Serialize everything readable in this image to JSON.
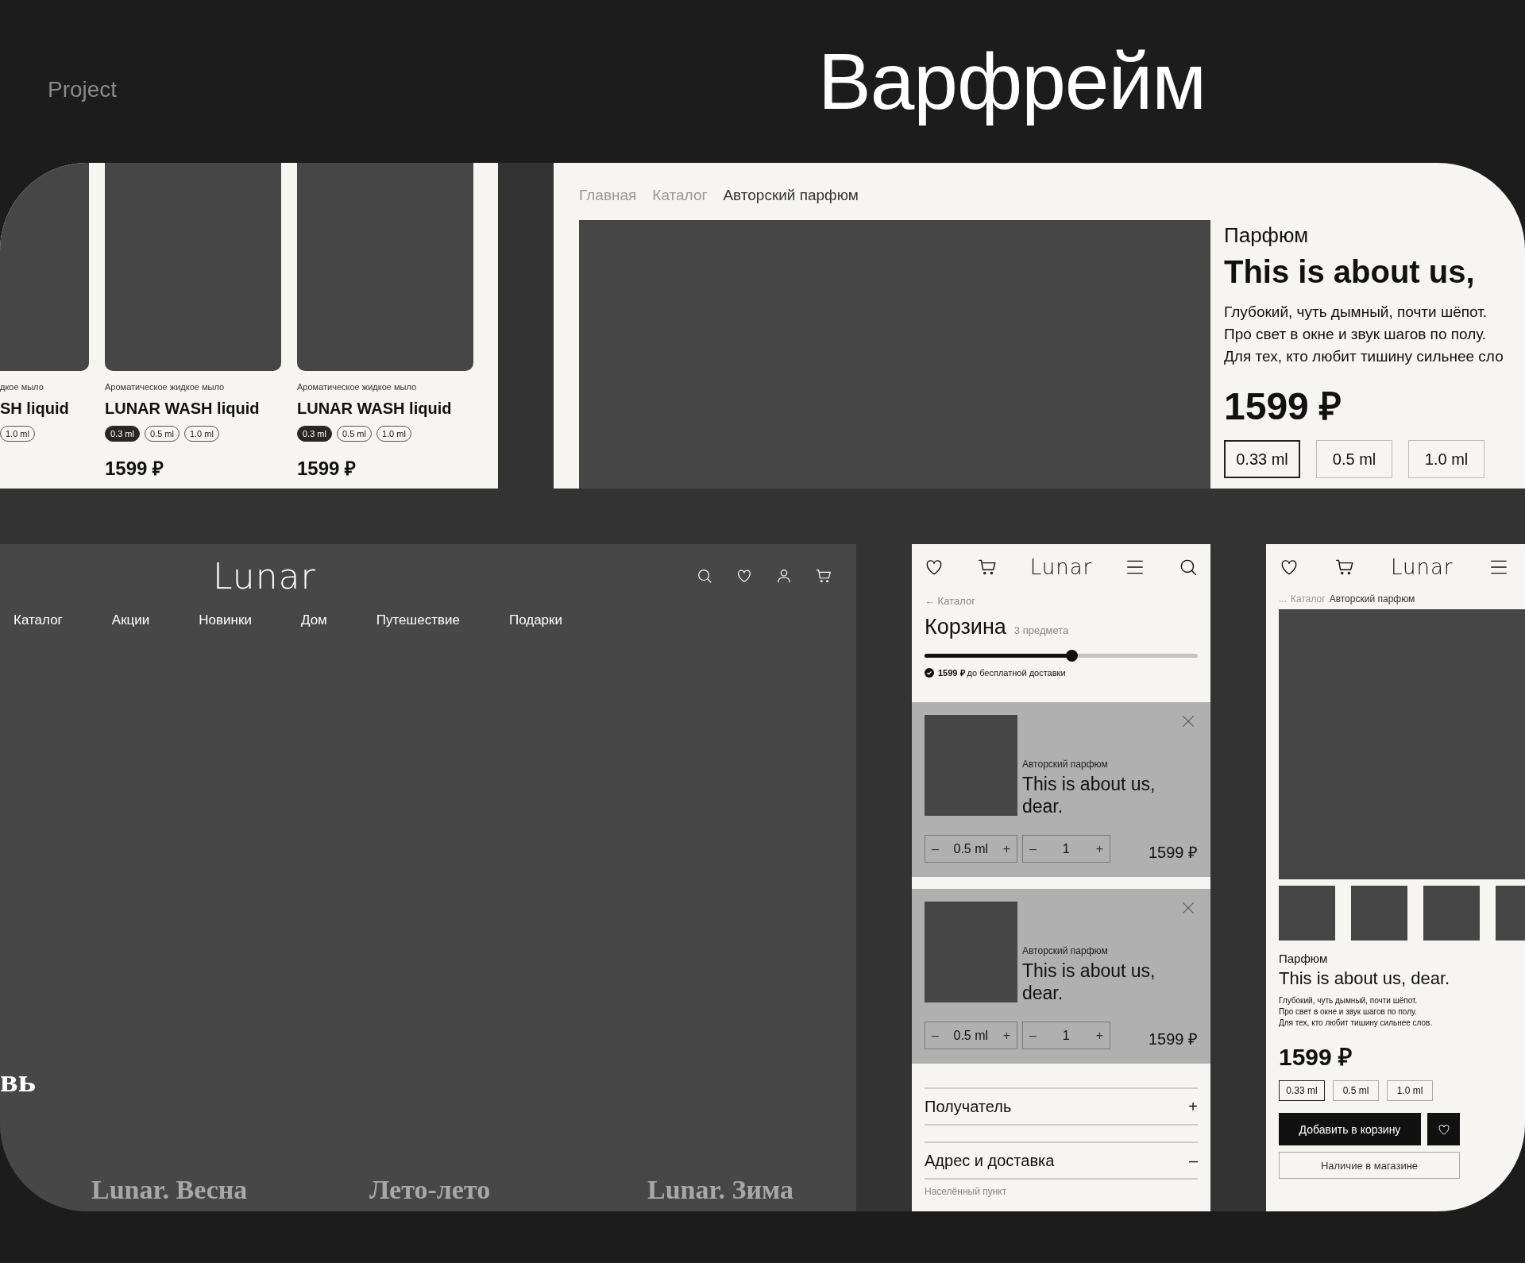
{
  "header": {
    "project": "Project",
    "title": "Варфрейм"
  },
  "catalog_cards": [
    {
      "kind": "partial",
      "category": "дкое мыло",
      "title": "SH liquid",
      "sizes": [
        {
          "label": "1.0 ml",
          "selected": false
        }
      ]
    },
    {
      "kind": "full",
      "category": "Ароматическое жидкое мыло",
      "title": "LUNAR WASH liquid",
      "sizes": [
        {
          "label": "0.3 ml",
          "selected": true
        },
        {
          "label": "0.5 ml",
          "selected": false
        },
        {
          "label": "1.0 ml",
          "selected": false
        }
      ],
      "price": "1599 ₽"
    },
    {
      "kind": "full",
      "category": "Ароматическое жидкое мыло",
      "title": "LUNAR WASH liquid",
      "sizes": [
        {
          "label": "0.3 ml",
          "selected": true
        },
        {
          "label": "0.5 ml",
          "selected": false
        },
        {
          "label": "1.0 ml",
          "selected": false
        }
      ],
      "price": "1599 ₽"
    }
  ],
  "product_page": {
    "breadcrumbs": [
      {
        "label": "Главная",
        "current": false
      },
      {
        "label": "Каталог",
        "current": false
      },
      {
        "label": "Авторский парфюм",
        "current": true
      }
    ],
    "category": "Парфюм",
    "title": "This is about us,",
    "description": [
      "Глубокий, чуть дымный, почти шёпот.",
      "Про свет в окне и звук шагов по полу.",
      "Для тех, кто любит тишину сильнее сло"
    ],
    "price": "1599 ₽",
    "sizes": [
      {
        "label": "0.33 ml",
        "selected": true
      },
      {
        "label": "0.5 ml",
        "selected": false
      },
      {
        "label": "1.0 ml",
        "selected": false
      }
    ]
  },
  "desktop_home": {
    "logo": "Lunar",
    "nav": [
      "Каталог",
      "Акции",
      "Новинки",
      "Дом",
      "Путешествие",
      "Подарки"
    ],
    "hero_fragment": "вь",
    "collections": [
      "Lunar. Весна",
      "Лето-лето",
      "Lunar. Зима"
    ]
  },
  "mobile_cart": {
    "logo": "Lunar",
    "back_link": "← Каталог",
    "title": "Корзина",
    "count": "3 предмета",
    "delivery_progress": {
      "level": 0.54
    },
    "delivery_note": "**1599 ₽** до бесплатной доставки",
    "items": [
      {
        "category": "Авторский парфюм",
        "title": "This is about us, dear.",
        "size": {
          "minus": "–",
          "value": "0.5 ml",
          "plus": "+"
        },
        "quantity": {
          "minus": "–",
          "value": "1",
          "plus": "+"
        },
        "price": "1599 ₽"
      },
      {
        "category": "Авторский парфюм",
        "title": "This is about us, dear.",
        "size": {
          "minus": "–",
          "value": "0.5 ml",
          "plus": "+"
        },
        "quantity": {
          "minus": "–",
          "value": "1",
          "plus": "+"
        },
        "price": "1599 ₽"
      }
    ],
    "sections": [
      {
        "label": "Получатель",
        "toggle": "+"
      },
      {
        "label": "Адрес и доставка",
        "toggle": "–",
        "fields": [
          "Населённый пункт"
        ]
      }
    ]
  },
  "mobile_product": {
    "logo": "Lunar",
    "breadcrumbs": [
      {
        "label": "...",
        "current": false
      },
      {
        "label": "Каталог",
        "current": false
      },
      {
        "label": "Авторский парфюм",
        "current": true
      }
    ],
    "category": "Парфюм",
    "title": "This is about us, dear.",
    "description": [
      "Глубокий, чуть дымный, почти шёпот.",
      "Про свет в окне и звук шагов по полу.",
      "Для тех, кто любит тишину сильнее слов."
    ],
    "price": "1599 ₽",
    "sizes": [
      {
        "label": "0.33 ml",
        "selected": true
      },
      {
        "label": "0.5 ml",
        "selected": false
      },
      {
        "label": "1.0 ml",
        "selected": false
      }
    ],
    "add_button": "Добавить в корзину",
    "availability_button": "Наличие в магазине"
  }
}
